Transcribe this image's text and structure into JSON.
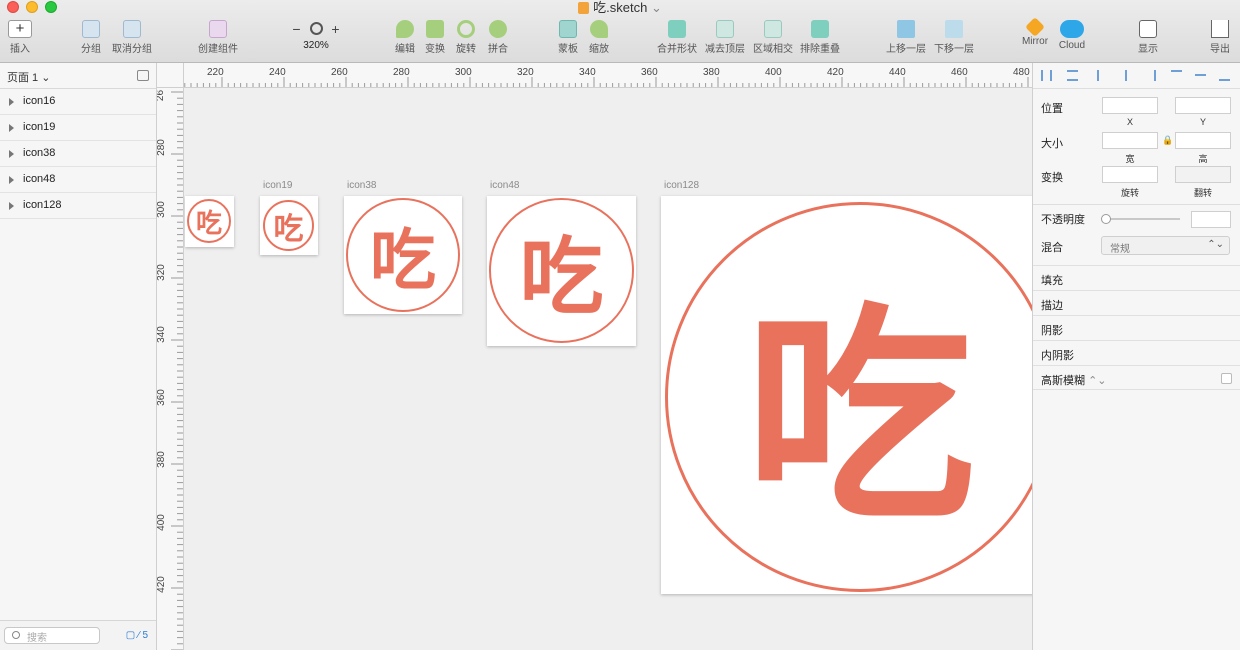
{
  "window": {
    "title": "吃.sketch"
  },
  "toolbar": {
    "insert": "插入",
    "group": "分组",
    "ungroup": "取消分组",
    "create_symbol": "创建组件",
    "zoom_minus": "−",
    "zoom_plus": "+",
    "zoom_value": "320%",
    "edit": "编辑",
    "transform": "变换",
    "rotate": "旋转",
    "flatten": "拼合",
    "mask": "蒙板",
    "scale": "缩放",
    "union": "合并形状",
    "subtract": "减去顶层",
    "intersect": "区域相交",
    "difference": "排除重叠",
    "forward": "上移一层",
    "backward": "下移一层",
    "mirror": "Mirror",
    "cloud": "Cloud",
    "view": "显示",
    "export": "导出"
  },
  "sidebar": {
    "page": "页面 1",
    "layers": [
      {
        "label": "icon16"
      },
      {
        "label": "icon19"
      },
      {
        "label": "icon38"
      },
      {
        "label": "icon48"
      },
      {
        "label": "icon128"
      }
    ],
    "search_placeholder": "搜索",
    "badge": "5"
  },
  "ruler": {
    "h": [
      "220",
      "240",
      "260",
      "280",
      "300",
      "320",
      "340",
      "360",
      "380",
      "400",
      "420",
      "440",
      "460",
      "480"
    ],
    "v": [
      "280",
      "300",
      "320",
      "340",
      "360",
      "380",
      "400",
      "420"
    ],
    "v_top": "26"
  },
  "canvas": {
    "glyph": "吃",
    "artboards": [
      {
        "label": "icon19"
      },
      {
        "label": "icon38"
      },
      {
        "label": "icon48"
      },
      {
        "label": "icon128"
      }
    ],
    "accent": "#e9725d"
  },
  "inspector": {
    "position": "位置",
    "x": "X",
    "y": "Y",
    "size": "大小",
    "width": "宽",
    "height": "高",
    "transform": "变换",
    "rotate": "旋转",
    "flip": "翻转",
    "opacity": "不透明度",
    "blend": "混合",
    "blend_value": "常规",
    "fills": "填充",
    "borders": "描边",
    "shadows": "阴影",
    "inner_shadows": "内阴影",
    "blur": "高斯模糊"
  }
}
